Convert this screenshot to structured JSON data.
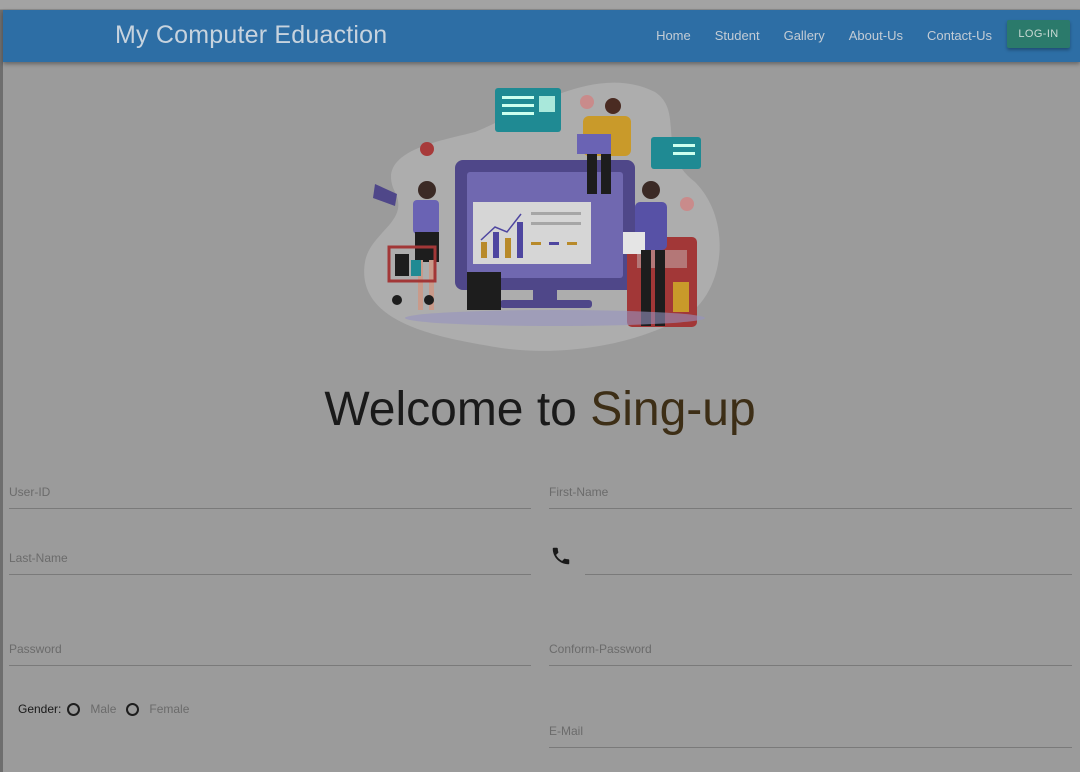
{
  "navbar": {
    "brand": "My Computer Eduaction",
    "links": [
      "Home",
      "Student",
      "Gallery",
      "About-Us",
      "Contact-Us"
    ],
    "login_label": "LOG-IN",
    "color": "#2d6ea5",
    "login_color": "#2b7a6b"
  },
  "hero": {
    "welcome_prefix": "Welcome to ",
    "welcome_accent": "Sing-up",
    "illustration": "people-with-computer-dashboard-illustration"
  },
  "form": {
    "user_id": "User-ID",
    "first_name": "First-Name",
    "last_name": "Last-Name",
    "phone_icon": "phone-icon",
    "password": "Password",
    "confirm_password": "Conform-Password",
    "email": "E-Mail",
    "gender_label": "Gender:",
    "gender_options": [
      "Male",
      "Female"
    ]
  }
}
